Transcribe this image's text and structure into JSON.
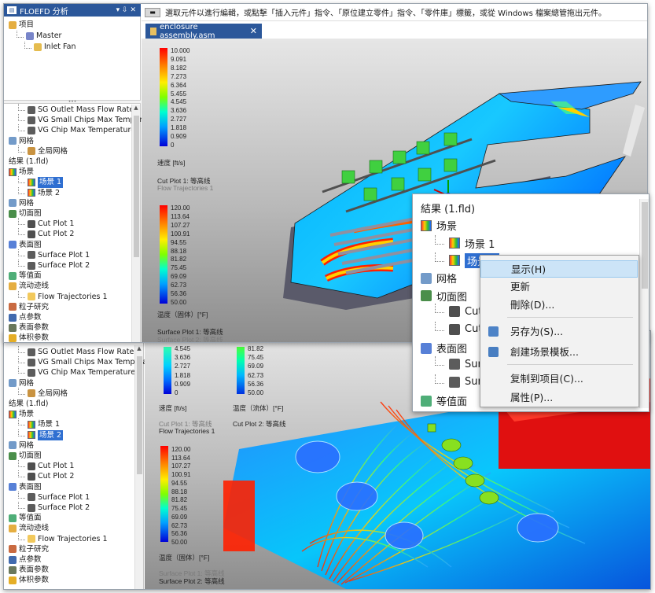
{
  "top_window": {
    "panel_title": "FLOEFD 分析",
    "panel_controls": [
      "▾ ⇩ ✕"
    ],
    "tree_top": [
      {
        "label": "项目",
        "icon": "project-icon",
        "indent": 0
      },
      {
        "label": "Master",
        "icon": "config-icon",
        "indent": 1
      },
      {
        "label": "Inlet Fan",
        "icon": "fan-icon",
        "indent": 2
      }
    ],
    "tree_bottom": [
      {
        "label": "SG Outlet Mass Flow Rate",
        "icon": "goal-icon",
        "indent": 1
      },
      {
        "label": "VG Small Chips Max Tempera",
        "icon": "goal-icon",
        "indent": 1
      },
      {
        "label": "VG Chip Max Temperature",
        "icon": "goal-icon",
        "indent": 1
      },
      {
        "label": "网格",
        "icon": "mesh-icon",
        "indent": 0
      },
      {
        "label": "全局网格",
        "icon": "global-mesh-icon",
        "indent": 1
      },
      {
        "label": "结果 (1.fld)",
        "icon": "",
        "indent": 0
      },
      {
        "label": "场景",
        "icon": "scene-icon",
        "indent": 0
      },
      {
        "label": "场景 1",
        "icon": "scene-item-icon",
        "indent": 1,
        "selected": true
      },
      {
        "label": "场景 2",
        "icon": "scene-item-icon",
        "indent": 1
      },
      {
        "label": "网格",
        "icon": "mesh-icon",
        "indent": 0
      },
      {
        "label": "切面图",
        "icon": "cut-plot-icon",
        "indent": 0
      },
      {
        "label": "Cut Plot 1",
        "icon": "cut-item-icon",
        "indent": 1
      },
      {
        "label": "Cut Plot 2",
        "icon": "cut-item-icon",
        "indent": 1
      },
      {
        "label": "表面图",
        "icon": "surface-plot-icon",
        "indent": 0
      },
      {
        "label": "Surface Plot 1",
        "icon": "surface-item-icon",
        "indent": 1
      },
      {
        "label": "Surface Plot 2",
        "icon": "surface-item-icon",
        "indent": 1
      },
      {
        "label": "等值面",
        "icon": "isosurface-icon",
        "indent": 0
      },
      {
        "label": "流动迹线",
        "icon": "trajectory-icon",
        "indent": 0
      },
      {
        "label": "Flow Trajectories 1",
        "icon": "trajectory-item-icon",
        "indent": 1
      },
      {
        "label": "粒子研究",
        "icon": "particle-icon",
        "indent": 0
      },
      {
        "label": "点参数",
        "icon": "point-param-icon",
        "indent": 0
      },
      {
        "label": "表面参数",
        "icon": "surface-param-icon",
        "indent": 0
      },
      {
        "label": "体积参数",
        "icon": "volume-param-icon",
        "indent": 0
      }
    ],
    "instruction": "選取元件以進行編輯，或點擊「插入元件」指令、「原位建立零件」指令、「零件庫」標籤，或從 Windows 檔案總管拖出元件。",
    "doc_tab": "enclosure assembly.asm",
    "colorbar1": {
      "ticks": [
        "10.000",
        "9.091",
        "8.182",
        "7.273",
        "6.364",
        "5.455",
        "4.545",
        "3.636",
        "2.727",
        "1.818",
        "0.909",
        "0"
      ],
      "unit_label": "速度 [ft/s]",
      "caption1": "Cut Plot 1: 等高线",
      "caption2": "Flow Trajectories 1"
    },
    "colorbar2": {
      "ticks": [
        "120.00",
        "113.64",
        "107.27",
        "100.91",
        "94.55",
        "88.18",
        "81.82",
        "75.45",
        "69.09",
        "62.73",
        "56.36",
        "50.00"
      ],
      "unit_label": "温度（固体）[°F]",
      "caption1": "Surface Plot 1: 等高线",
      "caption2": "Surface Plot 2: 等高线"
    }
  },
  "bottom_window": {
    "tree": [
      {
        "label": "SG Outlet Mass Flow Rate",
        "icon": "goal-icon",
        "indent": 1
      },
      {
        "label": "VG Small Chips Max Tempera",
        "icon": "goal-icon",
        "indent": 1
      },
      {
        "label": "VG Chip Max Temperature",
        "icon": "goal-icon",
        "indent": 1
      },
      {
        "label": "网格",
        "icon": "mesh-icon",
        "indent": 0
      },
      {
        "label": "全局网格",
        "icon": "global-mesh-icon",
        "indent": 1
      },
      {
        "label": "结果 (1.fld)",
        "icon": "",
        "indent": 0
      },
      {
        "label": "场景",
        "icon": "scene-icon",
        "indent": 0
      },
      {
        "label": "场景 1",
        "icon": "scene-item-icon",
        "indent": 1
      },
      {
        "label": "场景 2",
        "icon": "scene-item-icon",
        "indent": 1,
        "selected": true
      },
      {
        "label": "网格",
        "icon": "mesh-icon",
        "indent": 0
      },
      {
        "label": "切面图",
        "icon": "cut-plot-icon",
        "indent": 0
      },
      {
        "label": "Cut Plot 1",
        "icon": "cut-item-icon",
        "indent": 1
      },
      {
        "label": "Cut Plot 2",
        "icon": "cut-item-icon",
        "indent": 1
      },
      {
        "label": "表面图",
        "icon": "surface-plot-icon",
        "indent": 0
      },
      {
        "label": "Surface Plot 1",
        "icon": "surface-item-icon",
        "indent": 1
      },
      {
        "label": "Surface Plot 2",
        "icon": "surface-item-icon",
        "indent": 1
      },
      {
        "label": "等值面",
        "icon": "isosurface-icon",
        "indent": 0
      },
      {
        "label": "流动迹线",
        "icon": "trajectory-icon",
        "indent": 0
      },
      {
        "label": "Flow Trajectories 1",
        "icon": "trajectory-item-icon",
        "indent": 1
      },
      {
        "label": "粒子研究",
        "icon": "particle-icon",
        "indent": 0
      },
      {
        "label": "点参数",
        "icon": "point-param-icon",
        "indent": 0
      },
      {
        "label": "表面参数",
        "icon": "surface-param-icon",
        "indent": 0
      },
      {
        "label": "体积参数",
        "icon": "volume-param-icon",
        "indent": 0
      }
    ],
    "colorbar1_partial": {
      "ticks": [
        "4.545",
        "3.636",
        "2.727",
        "1.818",
        "0.909",
        "0"
      ],
      "unit_label": "速度 [ft/s]",
      "caption1": "Cut Plot 1: 等高线",
      "caption2": "Flow Trajectories 1"
    },
    "colorbar_fluid_partial": {
      "ticks": [
        "81.82",
        "75.45",
        "69.09",
        "62.73",
        "56.36",
        "50.00"
      ],
      "unit_label": "温度（流体）[°F]",
      "caption1": "Cut Plot 2: 等高线"
    },
    "colorbar2": {
      "ticks": [
        "120.00",
        "113.64",
        "107.27",
        "100.91",
        "94.55",
        "88.18",
        "81.82",
        "75.45",
        "69.09",
        "62.73",
        "56.36",
        "50.00"
      ],
      "unit_label": "温度（固体）[°F]",
      "caption1": "Surface Plot 1: 等高线",
      "caption2": "Surface Plot 2: 等高线"
    }
  },
  "zoom_panel": {
    "items": [
      {
        "label": "結果 (1.fld)",
        "icon": "",
        "indent": 0
      },
      {
        "label": "场景",
        "icon": "scene-icon",
        "indent": 0
      },
      {
        "label": "场景 1",
        "icon": "scene-item-icon",
        "indent": 1
      },
      {
        "label": "场景 2",
        "icon": "scene-item-icon",
        "indent": 1,
        "selected": true
      },
      {
        "label": "网格",
        "icon": "mesh-icon",
        "indent": 0
      },
      {
        "label": "切面图",
        "icon": "cut-plot-icon",
        "indent": 0
      },
      {
        "label": "Cut P",
        "icon": "cut-item-icon",
        "indent": 1
      },
      {
        "label": "Cut P",
        "icon": "cut-item-icon",
        "indent": 1
      },
      {
        "label": "表面图",
        "icon": "surface-plot-icon",
        "indent": 0
      },
      {
        "label": "Surf",
        "icon": "surface-item-icon",
        "indent": 1
      },
      {
        "label": "Surf",
        "icon": "surface-item-icon",
        "indent": 1
      },
      {
        "label": "等值面",
        "icon": "isosurface-icon",
        "indent": 0
      }
    ],
    "menu": [
      {
        "label": "显示(H)",
        "highlighted": true
      },
      {
        "label": "更新"
      },
      {
        "label": "刪除(D)..."
      },
      {
        "label": "另存为(S)...",
        "icon": "save-as-icon"
      },
      {
        "label": "創建场景模板...",
        "icon": "template-icon"
      },
      {
        "label": "复制到项目(C)..."
      },
      {
        "label": "属性(P)..."
      }
    ]
  }
}
